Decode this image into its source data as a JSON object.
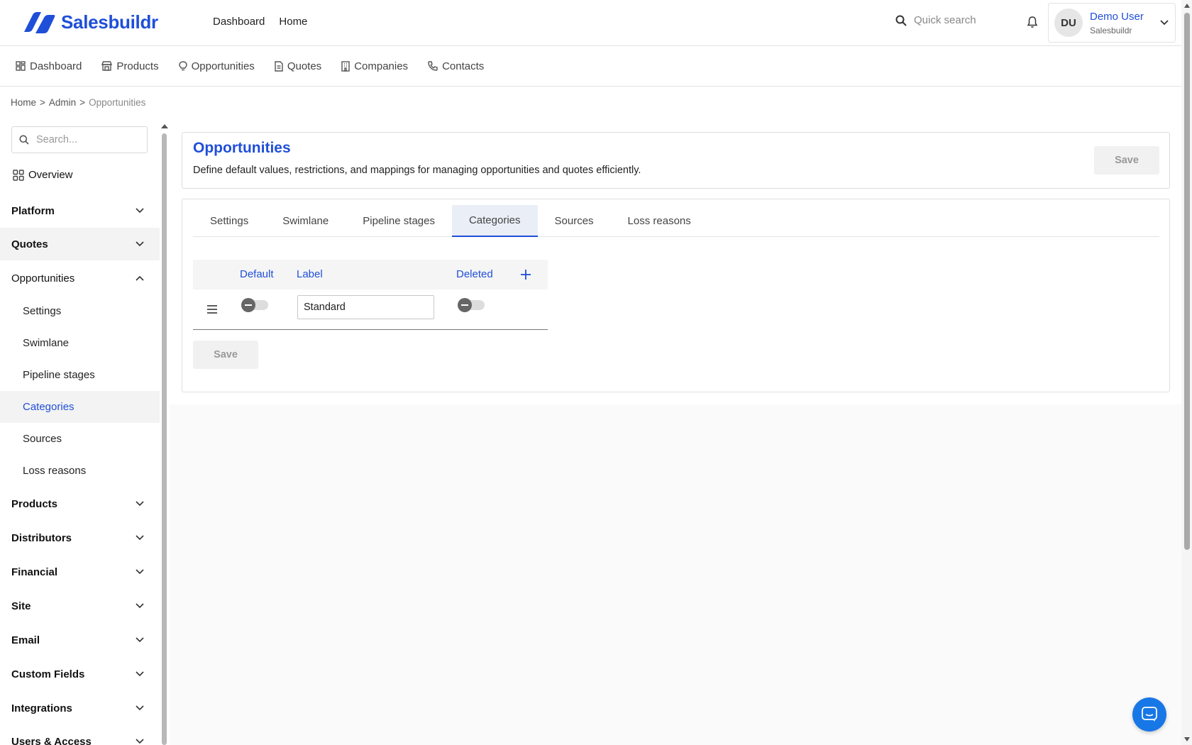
{
  "brand": {
    "name": "Salesbuildr",
    "color": "#1f4fd8"
  },
  "topnav": {
    "items": [
      "Dashboard",
      "Home"
    ]
  },
  "search": {
    "placeholder": "Quick search"
  },
  "user": {
    "initials": "DU",
    "name": "Demo User",
    "org": "Salesbuildr"
  },
  "subnav": {
    "items": [
      {
        "label": "Dashboard",
        "icon": "grid-icon"
      },
      {
        "label": "Products",
        "icon": "shop-icon"
      },
      {
        "label": "Opportunities",
        "icon": "lightbulb-icon"
      },
      {
        "label": "Quotes",
        "icon": "document-icon"
      },
      {
        "label": "Companies",
        "icon": "building-icon"
      },
      {
        "label": "Contacts",
        "icon": "phone-icon"
      }
    ]
  },
  "breadcrumb": {
    "items": [
      "Home",
      ">",
      "Admin",
      ">",
      "Opportunities"
    ]
  },
  "sidebar": {
    "search_placeholder": "Search...",
    "overview": "Overview",
    "sections": [
      {
        "label": "Platform"
      },
      {
        "label": "Quotes"
      },
      {
        "label": "Opportunities"
      },
      {
        "label": "Products"
      },
      {
        "label": "Distributors"
      },
      {
        "label": "Financial"
      },
      {
        "label": "Site"
      },
      {
        "label": "Email"
      },
      {
        "label": "Custom Fields"
      },
      {
        "label": "Integrations"
      },
      {
        "label": "Users & Access"
      }
    ],
    "opportunity_items": [
      "Settings",
      "Swimlane",
      "Pipeline stages",
      "Categories",
      "Sources",
      "Loss reasons"
    ],
    "active_item": "Categories"
  },
  "page": {
    "title": "Opportunities",
    "description": "Define default values, restrictions, and mappings for managing opportunities and quotes efficiently.",
    "save_label": "Save"
  },
  "tabs": {
    "items": [
      "Settings",
      "Swimlane",
      "Pipeline stages",
      "Categories",
      "Sources",
      "Loss reasons"
    ],
    "active": "Categories"
  },
  "grid": {
    "headers": {
      "default": "Default",
      "label": "Label",
      "deleted": "Deleted",
      "add": "+"
    },
    "rows": [
      {
        "label_value": "Standard",
        "default": false,
        "deleted": false
      }
    ],
    "save_label": "Save"
  }
}
